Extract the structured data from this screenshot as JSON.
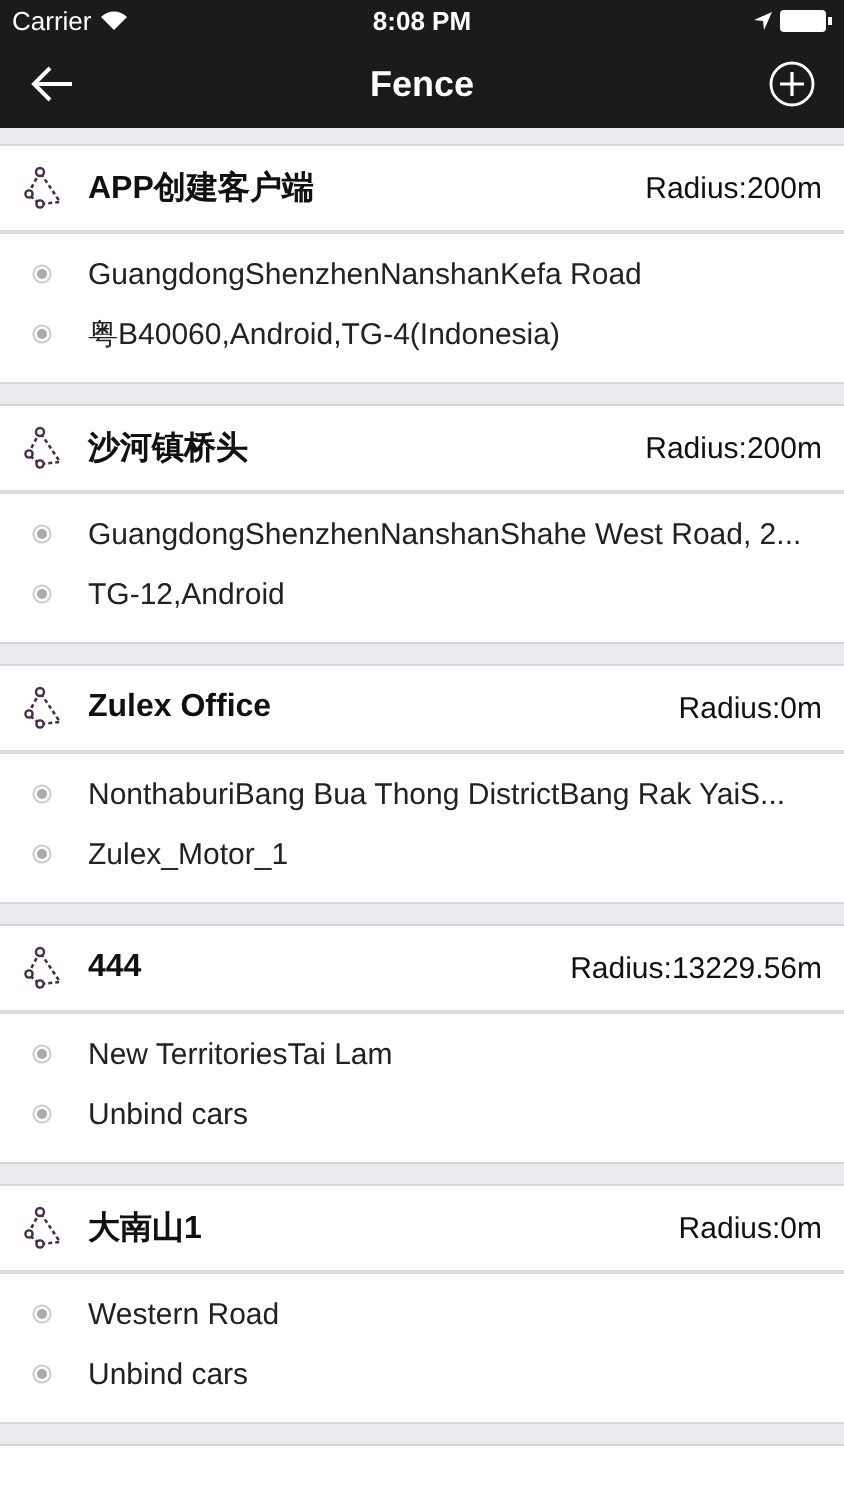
{
  "status_bar": {
    "carrier": "Carrier",
    "time": "8:08 PM"
  },
  "nav": {
    "title": "Fence"
  },
  "fences": [
    {
      "name": "APP创建客户端",
      "radius": "Radius:200m",
      "address": "GuangdongShenzhenNanshanKefa Road",
      "cars": "粤B40060,Android,TG-4(Indonesia)"
    },
    {
      "name": "沙河镇桥头",
      "radius": "Radius:200m",
      "address": "GuangdongShenzhenNanshanShahe West Road, 2...",
      "cars": "TG-12,Android"
    },
    {
      "name": "Zulex Office",
      "radius": "Radius:0m",
      "address": "NonthaburiBang Bua Thong DistrictBang Rak YaiS...",
      "cars": "Zulex_Motor_1"
    },
    {
      "name": "444",
      "radius": "Radius:13229.56m",
      "address": "New TerritoriesTai Lam",
      "cars": "Unbind cars"
    },
    {
      "name": "大南山1",
      "radius": "Radius:0m",
      "address": "Western Road",
      "cars": "Unbind cars"
    }
  ]
}
